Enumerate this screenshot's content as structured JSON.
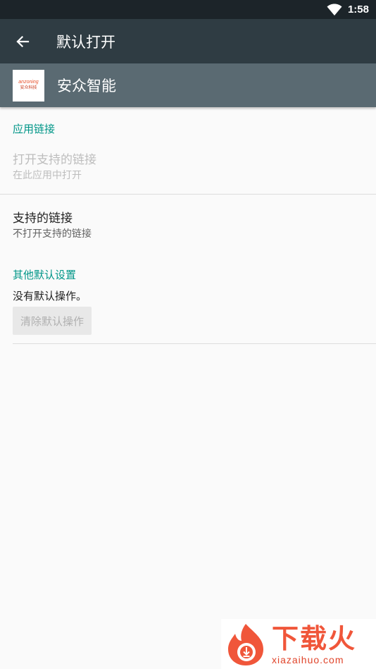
{
  "status_bar": {
    "time": "1:58"
  },
  "app_bar": {
    "title": "默认打开"
  },
  "app_header": {
    "app_name": "安众智能",
    "logo_text_top": "anzoning",
    "logo_text_bottom": "安众科技"
  },
  "app_links": {
    "section_title": "应用链接",
    "open_supported": {
      "title": "打开支持的链接",
      "subtitle": "在此应用中打开"
    },
    "supported_links": {
      "title": "支持的链接",
      "subtitle": "不打开支持的链接"
    }
  },
  "other_defaults": {
    "section_title": "其他默认设置",
    "message": "没有默认操作。",
    "clear_button": "清除默认操作"
  },
  "watermark": {
    "cn": "下载火",
    "en": "xiazaihuo.com"
  },
  "colors": {
    "accent": "#009688",
    "toolbar": "#2f3c43",
    "status_bar": "#1c2429",
    "header": "#5a6a72"
  }
}
